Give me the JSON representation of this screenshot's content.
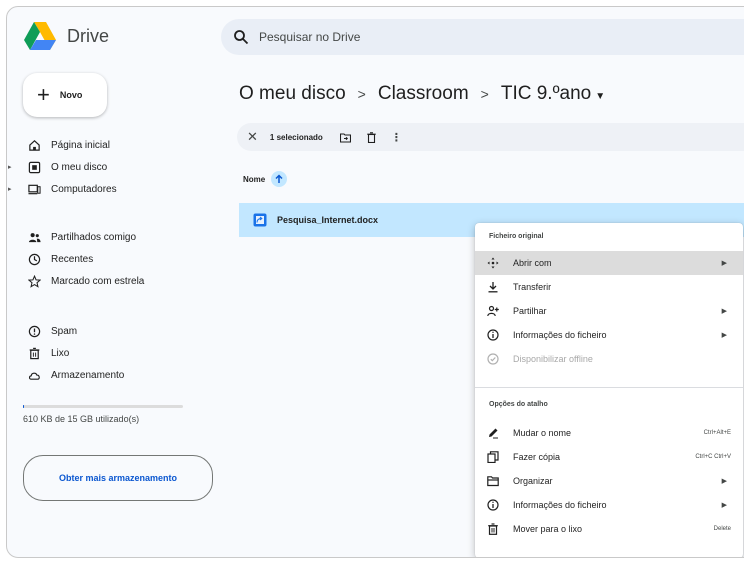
{
  "app": {
    "title": "Drive"
  },
  "search": {
    "placeholder": "Pesquisar no Drive"
  },
  "sidebar": {
    "new_label": "Novo",
    "items": [
      {
        "label": "Página inicial",
        "icon": "home-icon"
      },
      {
        "label": "O meu disco",
        "icon": "my-drive-icon"
      },
      {
        "label": "Computadores",
        "icon": "computers-icon"
      },
      {
        "label": "Partilhados comigo",
        "icon": "shared-icon"
      },
      {
        "label": "Recentes",
        "icon": "recent-icon"
      },
      {
        "label": "Marcado com estrela",
        "icon": "star-icon"
      },
      {
        "label": "Spam",
        "icon": "spam-icon"
      },
      {
        "label": "Lixo",
        "icon": "trash-icon"
      },
      {
        "label": "Armazenamento",
        "icon": "cloud-icon"
      }
    ],
    "storage_text": "610 KB de 15 GB utilizado(s)",
    "more_storage_label": "Obter mais armazenamento"
  },
  "breadcrumb": {
    "items": [
      "O meu disco",
      "Classroom",
      "TIC 9.ºano"
    ]
  },
  "selection": {
    "count_label": "1 selecionado"
  },
  "table": {
    "name_header": "Nome"
  },
  "files": [
    {
      "name": "Pesquisa_Internet.docx"
    }
  ],
  "context_menu": {
    "section1_label": "Ficheiro original",
    "section2_label": "Opções do atalho",
    "items": [
      {
        "label": "Abrir com",
        "shortcut": ""
      },
      {
        "label": "Transferir",
        "shortcut": ""
      },
      {
        "label": "Partilhar",
        "shortcut": ""
      },
      {
        "label": "Informações do ficheiro",
        "shortcut": ""
      },
      {
        "label": "Disponibilizar offline",
        "shortcut": ""
      },
      {
        "label": "Mudar o nome",
        "shortcut": "Ctrl+Alt+E"
      },
      {
        "label": "Fazer cópia",
        "shortcut": "Ctrl+C Ctrl+V"
      },
      {
        "label": "Organizar",
        "shortcut": ""
      },
      {
        "label": "Informações do ficheiro",
        "shortcut": ""
      },
      {
        "label": "Mover para o lixo",
        "shortcut": "Delete"
      }
    ]
  },
  "colors": {
    "accent": "#0b57d0",
    "selected_row": "#c2e7ff",
    "search_bg": "#e9eef6"
  }
}
